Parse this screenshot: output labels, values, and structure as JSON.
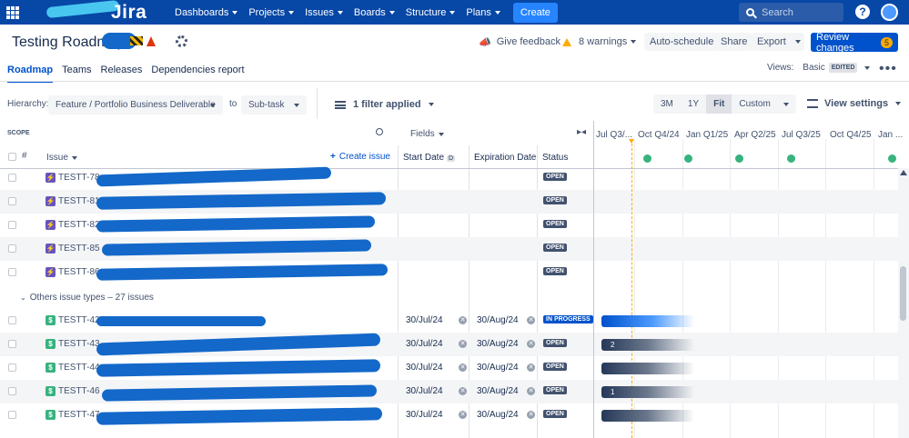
{
  "app": {
    "logo": "Jira"
  },
  "nav": {
    "items": [
      "Dashboards",
      "Projects",
      "Issues",
      "Boards",
      "Structure",
      "Plans"
    ],
    "create_label": "Create",
    "search_placeholder": "Search",
    "help_label": "?"
  },
  "header": {
    "title": "Testing Roadmap",
    "give_feedback": "Give feedback",
    "warnings": "8 warnings",
    "auto_schedule": "Auto-schedule",
    "share": "Share",
    "export": "Export",
    "review_changes": "Review changes",
    "review_count": "5"
  },
  "tabs": [
    "Roadmap",
    "Teams",
    "Releases",
    "Dependencies report"
  ],
  "views": {
    "label": "Views:",
    "current": "Basic",
    "badge": "EDITED",
    "more": "•••"
  },
  "filters": {
    "hierarchy_label": "Hierarchy:",
    "hierarchy_from": "Feature / Portfolio Business Deliverable",
    "to_label": "to",
    "hierarchy_to": "Sub-task",
    "filter_applied": "1 filter applied",
    "zoom_options": [
      "3M",
      "1Y",
      "Fit",
      "Custom"
    ],
    "zoom_selected": "Fit",
    "view_settings": "View settings"
  },
  "table": {
    "scope_label": "SCOPE",
    "fields_label": "Fields",
    "num_col": "#",
    "issue_col": "Issue",
    "create_issue": "Create issue",
    "start_col": "Start Date",
    "start_badge": "D",
    "expiration_col": "Expiration Date",
    "status_col": "Status",
    "group_label": "Others issue types – 27 issues",
    "rows_a": [
      {
        "key": "TESTT-78",
        "type": "⚡",
        "status": "OPEN"
      },
      {
        "key": "TESTT-81",
        "type": "⚡",
        "status": "OPEN"
      },
      {
        "key": "TESTT-82",
        "type": "⚡",
        "status": "OPEN"
      },
      {
        "key": "TESTT-85",
        "type": "⚡",
        "status": "OPEN"
      },
      {
        "key": "TESTT-86",
        "type": "⚡",
        "status": "OPEN"
      }
    ],
    "rows_b": [
      {
        "key": "TESTT-42",
        "type": "$",
        "start": "30/Jul/24",
        "end": "30/Aug/24",
        "status": "IN PROGRESS",
        "bar": ""
      },
      {
        "key": "TESTT-43",
        "type": "$",
        "start": "30/Jul/24",
        "end": "30/Aug/24",
        "status": "OPEN",
        "bar": "2"
      },
      {
        "key": "TESTT-44",
        "type": "$",
        "start": "30/Jul/24",
        "end": "30/Aug/24",
        "status": "OPEN",
        "bar": ""
      },
      {
        "key": "TESTT-46",
        "type": "$",
        "start": "30/Jul/24",
        "end": "30/Aug/24",
        "status": "OPEN",
        "bar": "1"
      },
      {
        "key": "TESTT-47",
        "type": "$",
        "start": "30/Jul/24",
        "end": "30/Aug/24",
        "status": "OPEN",
        "bar": ""
      }
    ]
  },
  "timeline": {
    "quarters": [
      "Jul Q3/...",
      "Oct Q4/24",
      "Jan Q1/25",
      "Apr Q2/25",
      "Jul Q3/25",
      "Oct Q4/25",
      "Jan ..."
    ]
  },
  "colors": {
    "nav": "#0747a6",
    "accent": "#0052cc",
    "release": "#36b37e",
    "today": "#ffab00"
  }
}
